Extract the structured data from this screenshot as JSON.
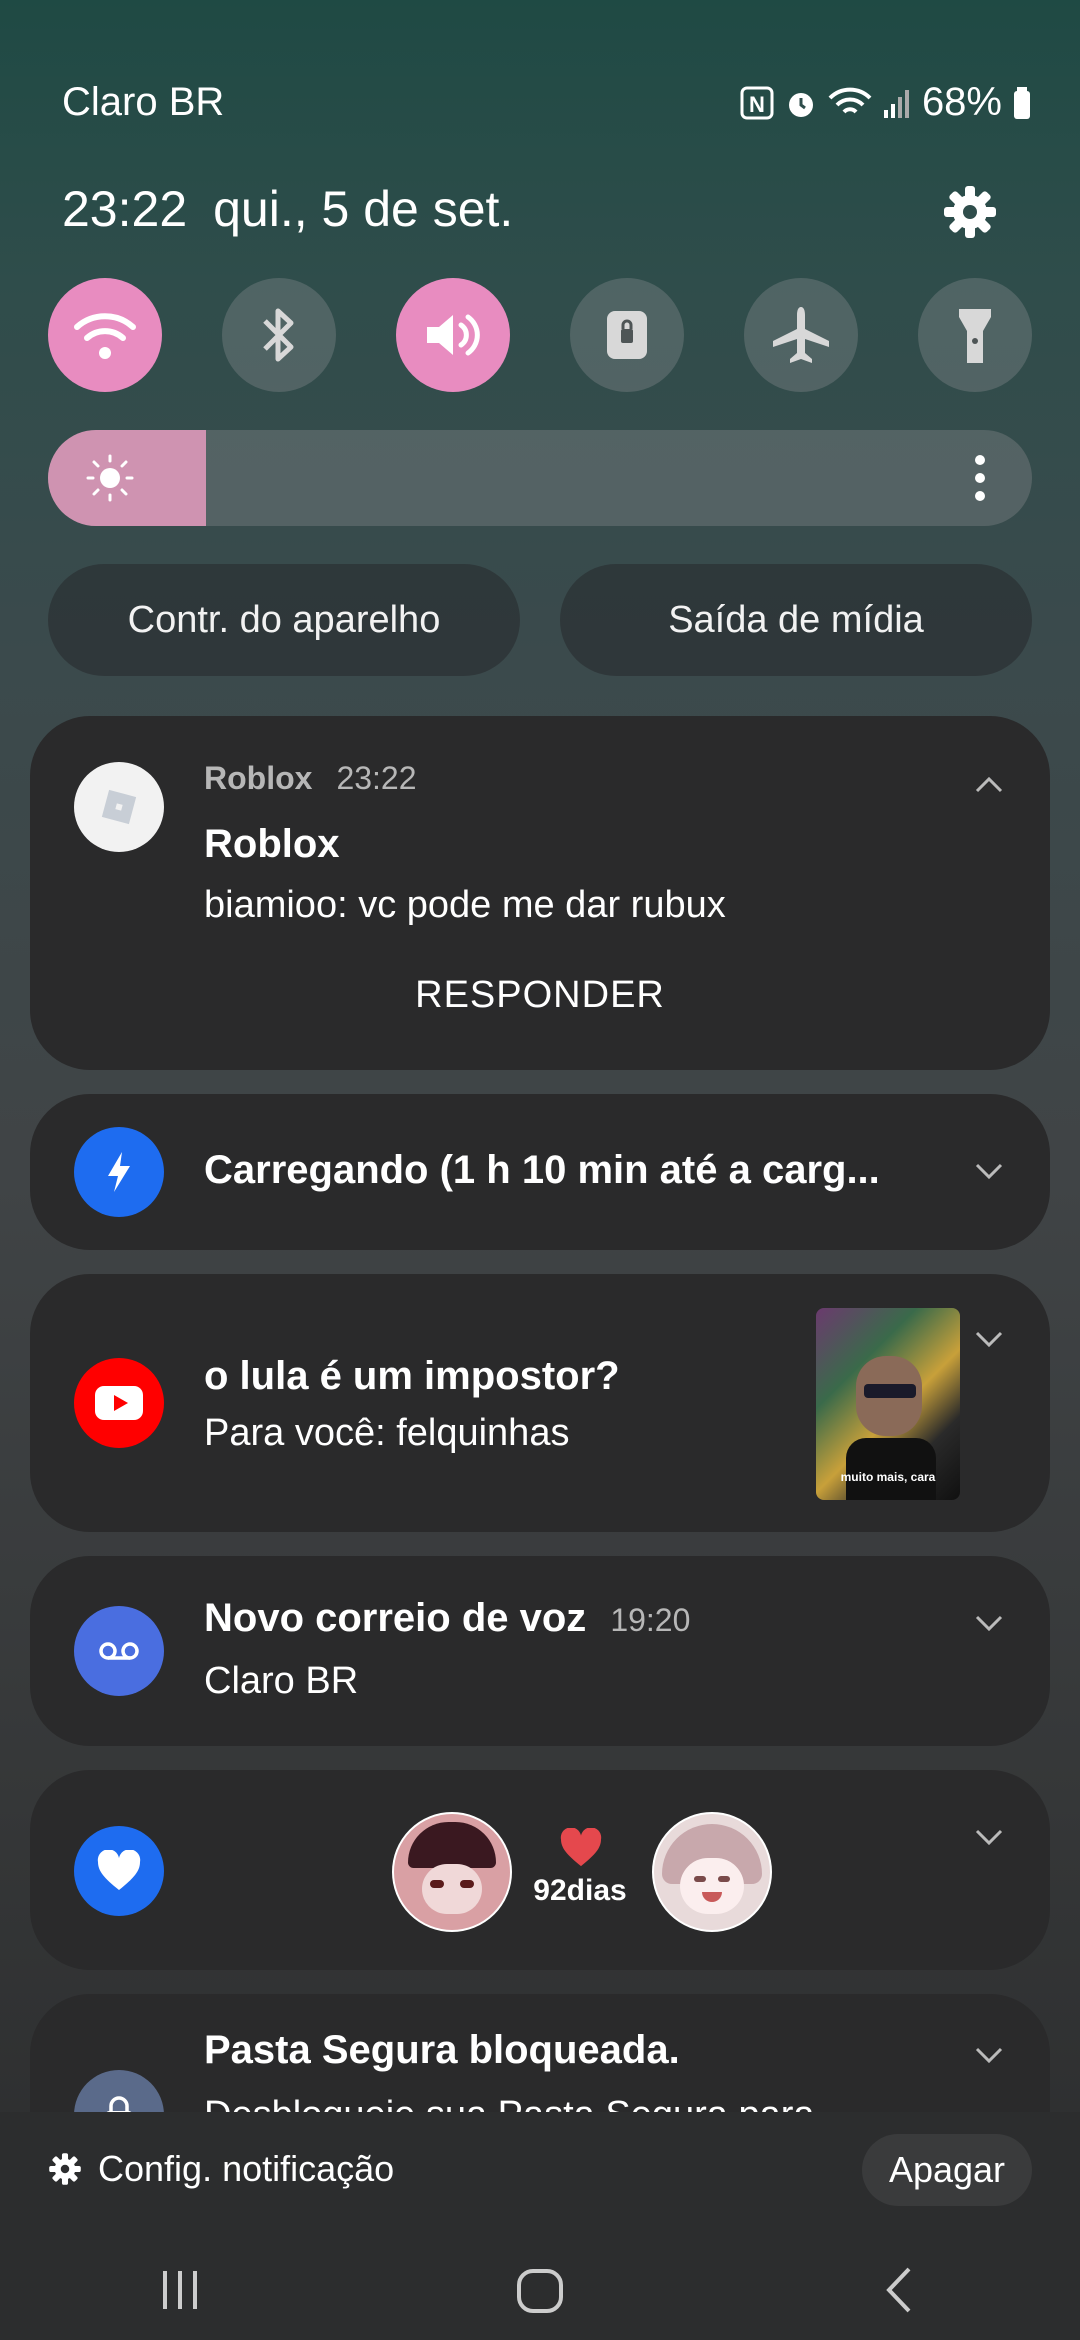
{
  "status_bar": {
    "carrier": "Claro BR",
    "battery": "68%"
  },
  "header": {
    "time": "23:22",
    "date": "qui., 5 de set."
  },
  "quick_toggles": [
    {
      "name": "wifi",
      "icon": "wifi-icon",
      "on": true
    },
    {
      "name": "bluetooth",
      "icon": "bluetooth-icon",
      "on": false
    },
    {
      "name": "sound",
      "icon": "volume-icon",
      "on": true
    },
    {
      "name": "rotation-lock",
      "icon": "lock-icon",
      "on": false
    },
    {
      "name": "airplane",
      "icon": "airplane-icon",
      "on": false
    },
    {
      "name": "flashlight",
      "icon": "flashlight-icon",
      "on": false
    }
  ],
  "brightness": {
    "level": 0.1
  },
  "pills": {
    "device_control": "Contr. do aparelho",
    "media_output": "Saída de mídia"
  },
  "notifications": {
    "roblox": {
      "app": "Roblox",
      "time": "23:22",
      "title": "Roblox",
      "text": "biamioo: vc pode me dar rubux",
      "action": "RESPONDER"
    },
    "charging": {
      "title": "Carregando (1 h 10 min até a carg..."
    },
    "youtube": {
      "title": "o lula é um impostor?",
      "text": "Para você: felquinhas",
      "thumb_caption": "muito mais, cara"
    },
    "voicemail": {
      "title": "Novo correio de voz",
      "time": "19:20",
      "text": "Claro BR"
    },
    "widget": {
      "days": "92dias"
    },
    "secure_folder": {
      "title": "Pasta Segura bloqueada.",
      "text": "Desbloqueie sua Pasta Segura para..."
    }
  },
  "footer": {
    "settings": "Config. notificação",
    "clear": "Apagar"
  },
  "colors": {
    "toggle_on": "#e88cc0",
    "card_bg": "#2a2a2b",
    "youtube_red": "#ff0000",
    "blue": "#1e6cf0"
  }
}
